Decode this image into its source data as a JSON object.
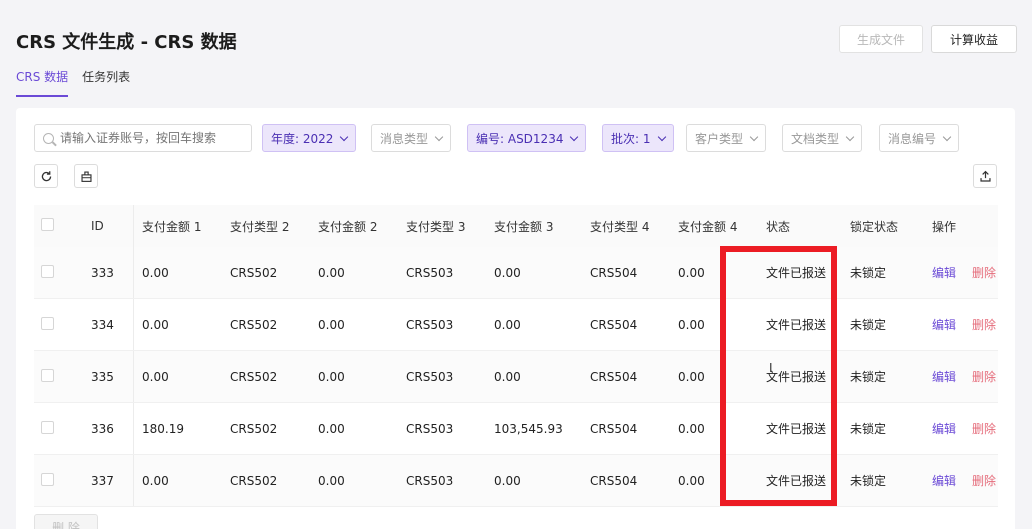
{
  "header": {
    "title": "CRS 文件生成 - CRS 数据",
    "generate_button": "生成文件",
    "calc_button": "计算收益"
  },
  "tabs": [
    {
      "label": "CRS 数据",
      "active": true
    },
    {
      "label": "任务列表",
      "active": false
    }
  ],
  "filters": {
    "search_placeholder": "请输入证券账号，按回车搜索",
    "year": "年度: 2022",
    "message_type": "消息类型",
    "code": "编号: ASD1234",
    "batch": "批次: 1",
    "customer_type": "客户类型",
    "doc_type": "文档类型",
    "message_no": "消息编号"
  },
  "toolbar": {
    "refresh_icon": "refresh-icon",
    "clear_icon": "clear-icon",
    "export_icon": "export-icon"
  },
  "table": {
    "columns": [
      "ID",
      "支付金额 1",
      "支付类型 2",
      "支付金额 2",
      "支付类型 3",
      "支付金额 3",
      "支付类型 4",
      "支付金额 4",
      "状态",
      "锁定状态",
      "操作"
    ],
    "rows": [
      {
        "id": "333",
        "amt1": "0.00",
        "type2": "CRS502",
        "amt2": "0.00",
        "type3": "CRS503",
        "amt3": "0.00",
        "type4": "CRS504",
        "amt4": "0.00",
        "status": "文件已报送",
        "lock": "未锁定",
        "edit": "编辑",
        "delete": "删除"
      },
      {
        "id": "334",
        "amt1": "0.00",
        "type2": "CRS502",
        "amt2": "0.00",
        "type3": "CRS503",
        "amt3": "0.00",
        "type4": "CRS504",
        "amt4": "0.00",
        "status": "文件已报送",
        "lock": "未锁定",
        "edit": "编辑",
        "delete": "删除"
      },
      {
        "id": "335",
        "amt1": "0.00",
        "type2": "CRS502",
        "amt2": "0.00",
        "type3": "CRS503",
        "amt3": "0.00",
        "type4": "CRS504",
        "amt4": "0.00",
        "status": "文件已报送",
        "lock": "未锁定",
        "edit": "编辑",
        "delete": "删除"
      },
      {
        "id": "336",
        "amt1": "180.19",
        "type2": "CRS502",
        "amt2": "0.00",
        "type3": "CRS503",
        "amt3": "103,545.93",
        "type4": "CRS504",
        "amt4": "0.00",
        "status": "文件已报送",
        "lock": "未锁定",
        "edit": "编辑",
        "delete": "删除"
      },
      {
        "id": "337",
        "amt1": "0.00",
        "type2": "CRS502",
        "amt2": "0.00",
        "type3": "CRS503",
        "amt3": "0.00",
        "type4": "CRS504",
        "amt4": "0.00",
        "status": "文件已报送",
        "lock": "未锁定",
        "edit": "编辑",
        "delete": "删除"
      }
    ]
  },
  "bulk_delete": "删 除",
  "colors": {
    "accent": "#6b4ad6",
    "danger": "#e56b7a",
    "highlight": "#ec1c24"
  }
}
